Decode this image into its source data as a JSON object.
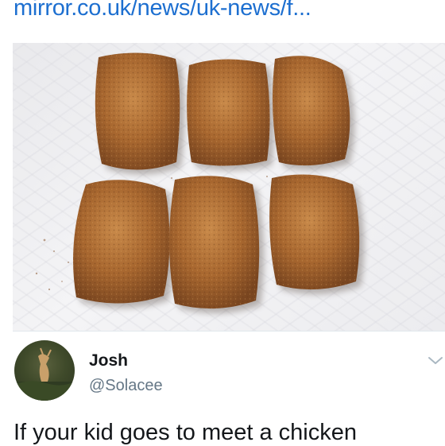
{
  "link_preview": {
    "url": "mirror.co.uk/news/uk-news/f...",
    "url_color": "#1d6fd0",
    "image_subject": "six chicken nuggets on a white paper towel"
  },
  "tweet": {
    "author_name": "Josh",
    "author_handle": "@Solacee",
    "text": "If your kid goes to meet a chicken",
    "more_icon": "chevron-down-icon"
  },
  "colors": {
    "text_primary": "#14171a",
    "text_secondary": "#657786",
    "divider": "#e1e8ed"
  }
}
